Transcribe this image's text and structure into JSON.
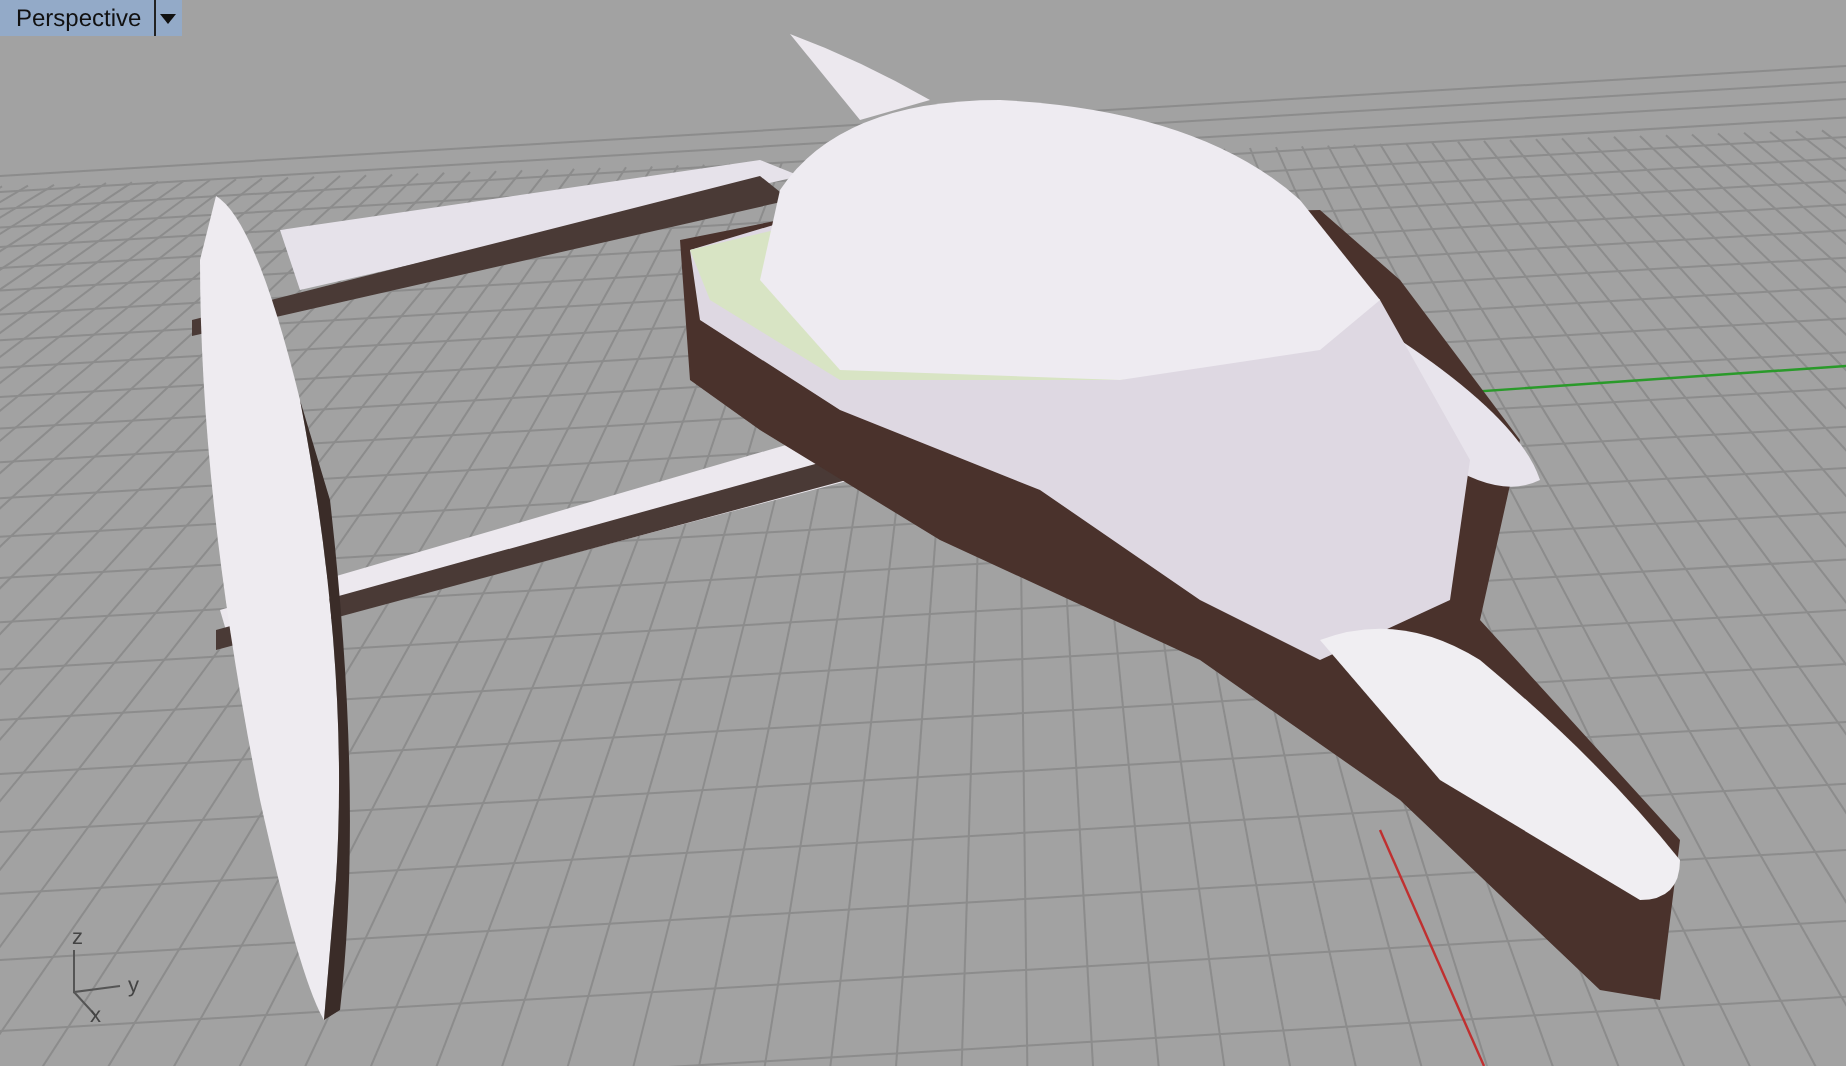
{
  "viewport": {
    "tab": {
      "label": "Perspective",
      "selected": true
    }
  },
  "axis_labels": [
    "z",
    "y",
    "x"
  ]
}
